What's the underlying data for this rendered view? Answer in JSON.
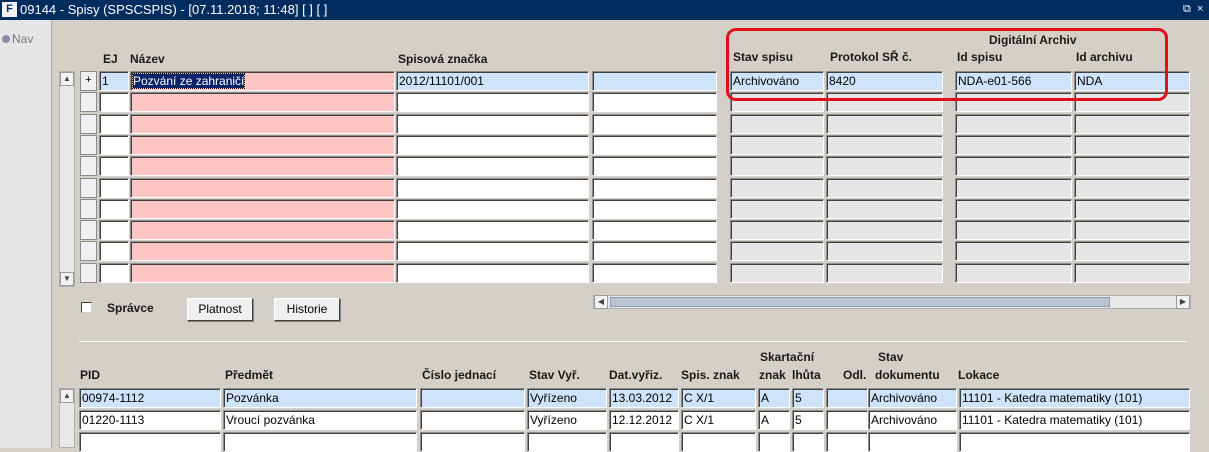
{
  "window": {
    "title": "09144 - Spisy (SPSCSPIS) - [07.11.2018; 11:48]  [ ] [ ]",
    "icon": "oracle-forms-icon",
    "controls": [
      "restore-icon",
      "close-icon"
    ],
    "restore_glyph": "⧉",
    "close_glyph": "×"
  },
  "nav": {
    "label": "Nav"
  },
  "upper": {
    "headers": {
      "ej": "EJ",
      "nazev": "Název",
      "spisova_znacka": "Spisová značka",
      "digitalni_archiv": "Digitální Archiv",
      "stav_spisu": "Stav spisu",
      "protokol": "Protokol SŘ č.",
      "id_spisu": "Id spisu",
      "id_archivu": "Id archivu"
    },
    "rows": [
      {
        "marker": "+",
        "ej": "1",
        "nazev": "Pozvání ze zahraničí",
        "spisova_znacka": "2012/11101/001",
        "extra": "",
        "stav_spisu": "Archivováno",
        "protokol": "8420",
        "id_spisu": "NDA-e01-566",
        "id_archivu": "NDA"
      },
      {
        "marker": "",
        "ej": "",
        "nazev": "",
        "spisova_znacka": "",
        "extra": "",
        "stav_spisu": "",
        "protokol": "",
        "id_spisu": "",
        "id_archivu": ""
      },
      {
        "marker": "",
        "ej": "",
        "nazev": "",
        "spisova_znacka": "",
        "extra": "",
        "stav_spisu": "",
        "protokol": "",
        "id_spisu": "",
        "id_archivu": ""
      },
      {
        "marker": "",
        "ej": "",
        "nazev": "",
        "spisova_znacka": "",
        "extra": "",
        "stav_spisu": "",
        "protokol": "",
        "id_spisu": "",
        "id_archivu": ""
      },
      {
        "marker": "",
        "ej": "",
        "nazev": "",
        "spisova_znacka": "",
        "extra": "",
        "stav_spisu": "",
        "protokol": "",
        "id_spisu": "",
        "id_archivu": ""
      },
      {
        "marker": "",
        "ej": "",
        "nazev": "",
        "spisova_znacka": "",
        "extra": "",
        "stav_spisu": "",
        "protokol": "",
        "id_spisu": "",
        "id_archivu": ""
      },
      {
        "marker": "",
        "ej": "",
        "nazev": "",
        "spisova_znacka": "",
        "extra": "",
        "stav_spisu": "",
        "protokol": "",
        "id_spisu": "",
        "id_archivu": ""
      },
      {
        "marker": "",
        "ej": "",
        "nazev": "",
        "spisova_znacka": "",
        "extra": "",
        "stav_spisu": "",
        "protokol": "",
        "id_spisu": "",
        "id_archivu": ""
      },
      {
        "marker": "",
        "ej": "",
        "nazev": "",
        "spisova_znacka": "",
        "extra": "",
        "stav_spisu": "",
        "protokol": "",
        "id_spisu": "",
        "id_archivu": ""
      },
      {
        "marker": "",
        "ej": "",
        "nazev": "",
        "spisova_znacka": "",
        "extra": "",
        "stav_spisu": "",
        "protokol": "",
        "id_spisu": "",
        "id_archivu": ""
      }
    ]
  },
  "controls": {
    "spravce_label": "Správce",
    "spravce_checked": false,
    "platnost_button": "Platnost",
    "historie_button": "Historie"
  },
  "lower": {
    "headers": {
      "pid": "PID",
      "predmet": "Předmět",
      "cislo_jednaci": "Číslo jednací",
      "stav_vyr": "Stav Vyř.",
      "dat_vyriz": "Dat.vyřiz.",
      "spis_znak": "Spis. znak",
      "skartacni": "Skartační",
      "znak": "znak",
      "lhuta": "lhůta",
      "odl": "Odl.",
      "stav": "Stav",
      "dokumentu": "dokumentu",
      "lokace": "Lokace"
    },
    "rows": [
      {
        "pid": "00974-1112",
        "predmet": "Pozvánka",
        "cislo_jednaci": "",
        "stav_vyr": "Vyřízeno",
        "dat_vyriz": "13.03.2012",
        "spis_znak": "C X/1",
        "znak": "A",
        "lhuta": "5",
        "odl": "",
        "stav_dokumentu": "Archivováno",
        "lokace": "11101 - Katedra matematiky (101)"
      },
      {
        "pid": "01220-1113",
        "predmet": "Vroucí pozvánka",
        "cislo_jednaci": "",
        "stav_vyr": "Vyřízeno",
        "dat_vyriz": "12.12.2012",
        "spis_znak": "C X/1",
        "znak": "A",
        "lhuta": "5",
        "odl": "",
        "stav_dokumentu": "Archivováno",
        "lokace": "11101 - Katedra matematiky (101)"
      },
      {
        "pid": "",
        "predmet": "",
        "cislo_jednaci": "",
        "stav_vyr": "",
        "dat_vyriz": "",
        "spis_znak": "",
        "znak": "",
        "lhuta": "",
        "odl": "",
        "stav_dokumentu": "",
        "lokace": ""
      }
    ]
  },
  "colors": {
    "required_field": "#ffc5c5",
    "readonly_field": "#e6e6e6",
    "current_record": "#cfe4fa",
    "annotation": "#e0101a",
    "titlebar": "#002c5f"
  }
}
